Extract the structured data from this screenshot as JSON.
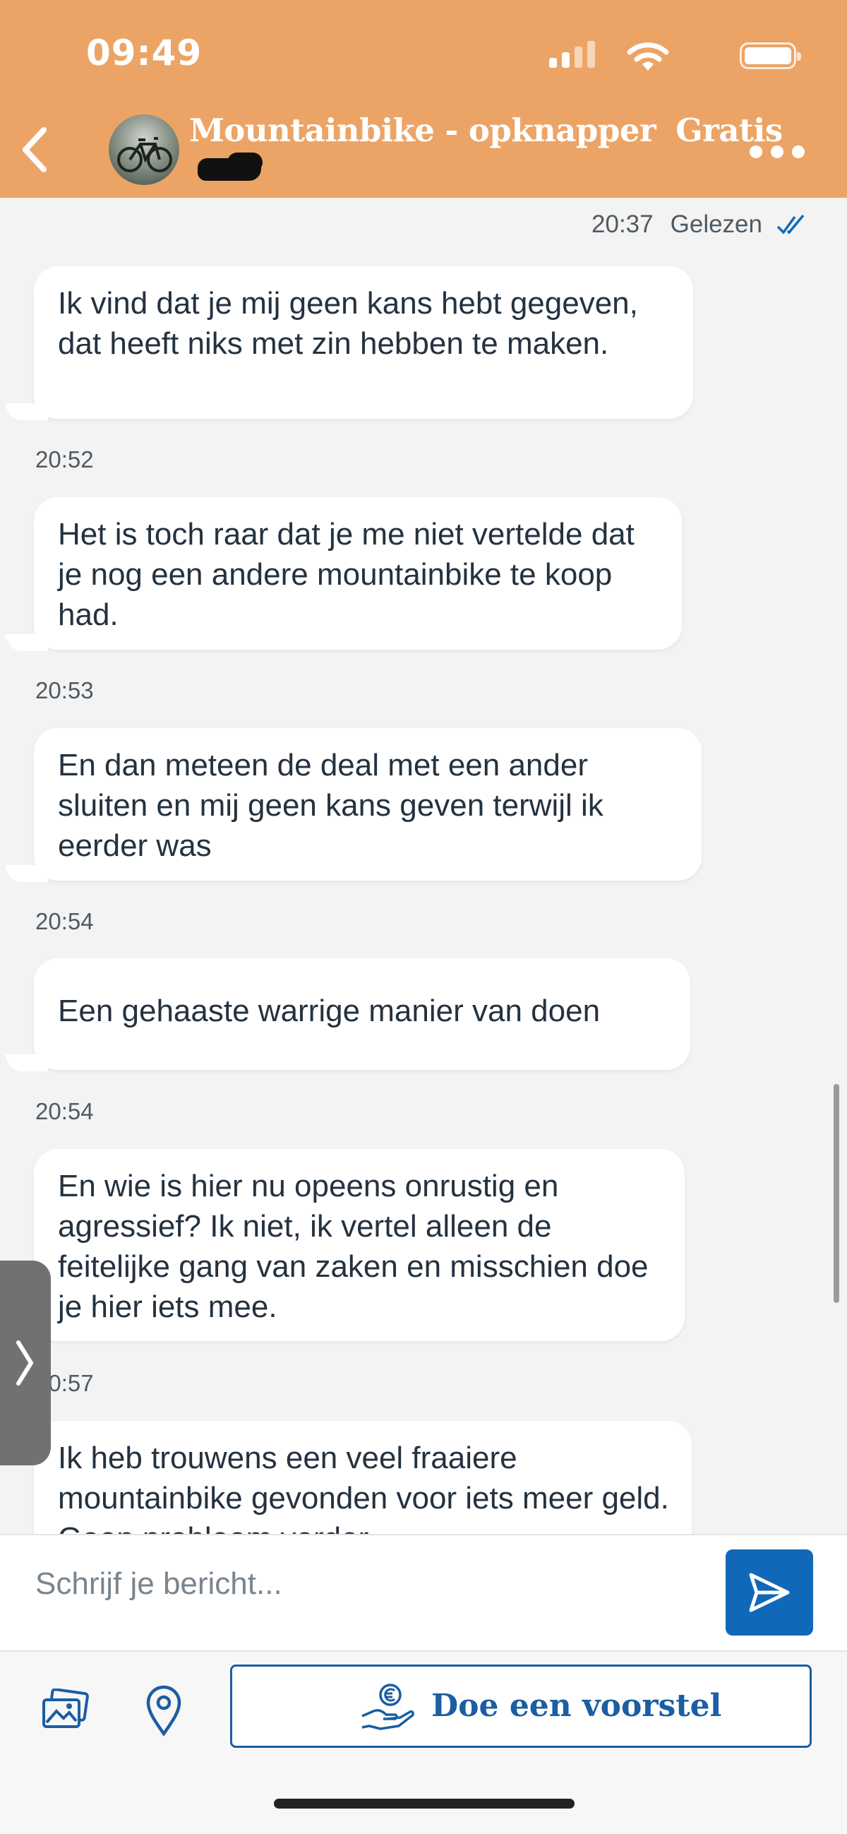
{
  "status_bar": {
    "time": "09:49"
  },
  "header": {
    "listing_title": "Mountainbike - opknapper",
    "price": "Gratis",
    "colors": {
      "background": "#eca466",
      "text": "#ffffff"
    }
  },
  "chat": {
    "read_receipt": {
      "time": "20:37",
      "label": "Gelezen"
    },
    "messages": [
      {
        "text": "Ik vind dat je mij geen kans hebt gegeven, dat heeft niks met zin hebben te maken."
      },
      {
        "time": "20:52",
        "text": "Het is toch raar dat je me niet vertelde dat je nog een andere mountainbike te koop had."
      },
      {
        "time": "20:53",
        "text": "En dan meteen de deal met een ander sluiten en mij geen kans geven terwijl ik eerder was"
      },
      {
        "time": "20:54",
        "text": "Een gehaaste warrige manier van doen"
      },
      {
        "time": "20:54",
        "text": "En wie is hier nu opeens onrustig en agressief? Ik niet, ik vertel alleen de feitelijke gang van zaken en misschien doe je hier iets mee."
      },
      {
        "time": "20:57",
        "text": "Ik heb trouwens een veel fraaiere mountainbike gevonden voor iets meer geld. Geen probleem verder."
      }
    ]
  },
  "composer": {
    "placeholder": "Schrijf je bericht..."
  },
  "actions": {
    "offer_label": "Doe een voorstel"
  },
  "icons": {
    "back": "chevron-left-icon",
    "more": "more-dots-icon",
    "send": "send-icon",
    "image": "image-gallery-icon",
    "location": "location-pin-icon",
    "offer": "hand-euro-icon",
    "read": "double-check-icon"
  },
  "colors": {
    "accent_blue": "#1168b9",
    "chat_background": "#f3f3f3",
    "bubble": "#ffffff"
  }
}
